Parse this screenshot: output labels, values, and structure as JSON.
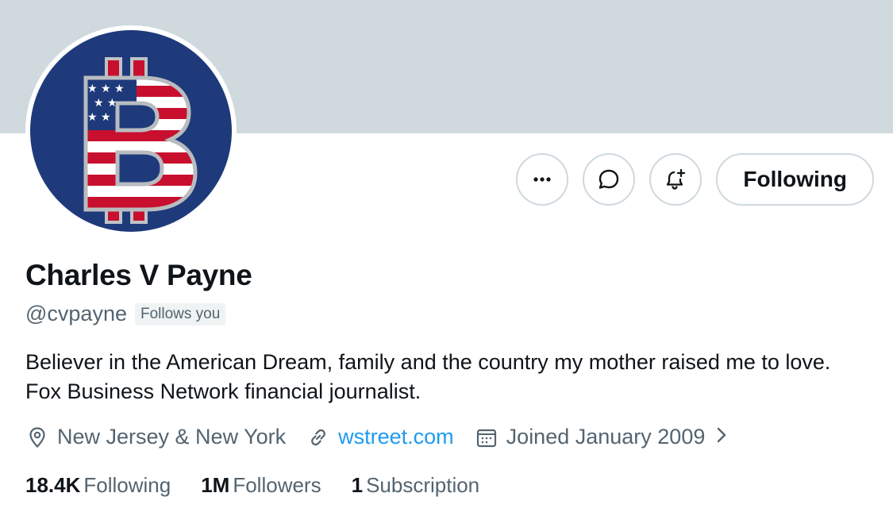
{
  "profile": {
    "name": "Charles V Payne",
    "handle": "@cvpayne",
    "follows_you": "Follows you",
    "bio": "Believer in the American Dream, family and the country my mother raised me to love. Fox Business Network financial journalist.",
    "location": "New Jersey & New York",
    "website": "wstreet.com",
    "joined": "Joined January 2009"
  },
  "actions": {
    "more_icon": "more-icon",
    "message_icon": "message-icon",
    "notify_icon": "bell-plus-icon",
    "follow_label": "Following"
  },
  "stats": {
    "following_count": "18.4K",
    "following_label": "Following",
    "followers_count": "1M",
    "followers_label": "Followers",
    "subscriptions_count": "1",
    "subscriptions_label": "Subscription"
  },
  "colors": {
    "banner": "#cfd9de",
    "link": "#1d9bf0",
    "secondary_text": "#536471",
    "avatar_bg": "#1e3a7b",
    "flag_red": "#c8102e"
  }
}
